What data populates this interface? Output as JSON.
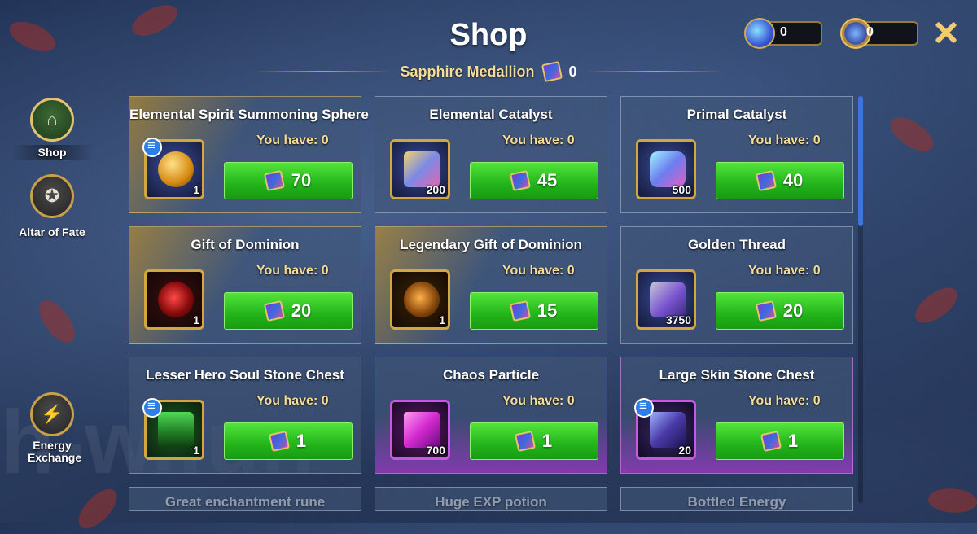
{
  "title": "Shop",
  "subtitle": {
    "label": "Sapphire Medallion",
    "value": "0"
  },
  "currencies": {
    "crystal": "0",
    "medal": "0"
  },
  "sidebar": {
    "items": [
      {
        "label": "Shop",
        "icon": "shop-icon"
      },
      {
        "label": "Altar of Fate",
        "icon": "star-icon"
      },
      {
        "label": "Energy Exchange",
        "icon": "lightning-icon"
      }
    ]
  },
  "have_prefix": "You have: ",
  "cards": [
    {
      "name": "Elemental Spirit Summoning Sphere",
      "have": "You have: 0",
      "qty": "1",
      "price": "70"
    },
    {
      "name": "Elemental Catalyst",
      "have": "You have: 0",
      "qty": "200",
      "price": "45"
    },
    {
      "name": "Primal Catalyst",
      "have": "You have: 0",
      "qty": "500",
      "price": "40"
    },
    {
      "name": "Gift of Dominion",
      "have": "You have: 0",
      "qty": "1",
      "price": "20"
    },
    {
      "name": "Legendary Gift of Dominion",
      "have": "You have: 0",
      "qty": "1",
      "price": "15"
    },
    {
      "name": "Golden Thread",
      "have": "You have: 0",
      "qty": "3750",
      "price": "20"
    },
    {
      "name": "Lesser Hero Soul Stone Chest",
      "have": "You have: 0",
      "qty": "1",
      "price": "1"
    },
    {
      "name": "Chaos Particle",
      "have": "You have: 0",
      "qty": "700",
      "price": "1"
    },
    {
      "name": "Large Skin Stone Chest",
      "have": "You have: 0",
      "qty": "20",
      "price": "1"
    },
    {
      "name": "Great enchantment rune"
    },
    {
      "name": "Huge EXP potion"
    },
    {
      "name": "Bottled Energy"
    }
  ],
  "watermark": "h-w.fun"
}
